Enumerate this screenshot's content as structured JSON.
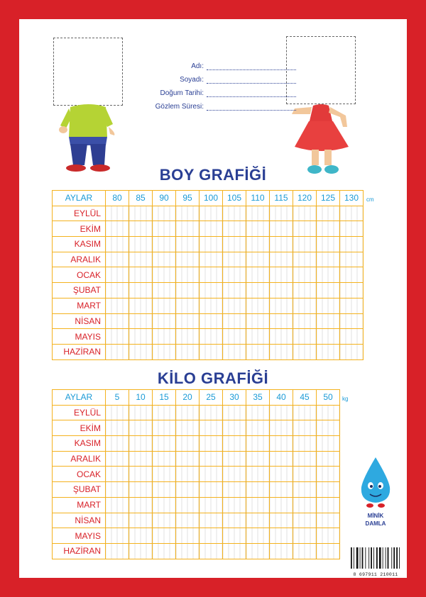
{
  "form": {
    "fields": [
      {
        "label": "Adı:"
      },
      {
        "label": "Soyadı:"
      },
      {
        "label": "Doğum Tarihi:"
      },
      {
        "label": "Gözlem Süresi:"
      }
    ]
  },
  "boy": {
    "title": "BOY GRAFİĞİ",
    "header": "AYLAR",
    "columns": [
      "80",
      "85",
      "90",
      "95",
      "100",
      "105",
      "110",
      "115",
      "120",
      "125",
      "130"
    ],
    "unit": "cm",
    "months": [
      "EYLÜL",
      "EKİM",
      "KASIM",
      "ARALIK",
      "OCAK",
      "ŞUBAT",
      "MART",
      "NİSAN",
      "MAYIS",
      "HAZİRAN"
    ]
  },
  "kilo": {
    "title": "KİLO GRAFİĞİ",
    "header": "AYLAR",
    "columns": [
      "5",
      "10",
      "15",
      "20",
      "25",
      "30",
      "35",
      "40",
      "45",
      "50"
    ],
    "unit": "kg",
    "months": [
      "EYLÜL",
      "EKİM",
      "KASIM",
      "ARALIK",
      "OCAK",
      "ŞUBAT",
      "MART",
      "NİSAN",
      "MAYIS",
      "HAZİRAN"
    ]
  },
  "logo": {
    "line1": "MİNİK",
    "line2": "DAMLA"
  },
  "barcode": {
    "number": "8 697911 210011"
  },
  "colors": {
    "border": "#d82128",
    "grid": "#f4b21e",
    "header_text": "#1a9ad6",
    "month_text": "#d82128",
    "title": "#2a3f94"
  }
}
